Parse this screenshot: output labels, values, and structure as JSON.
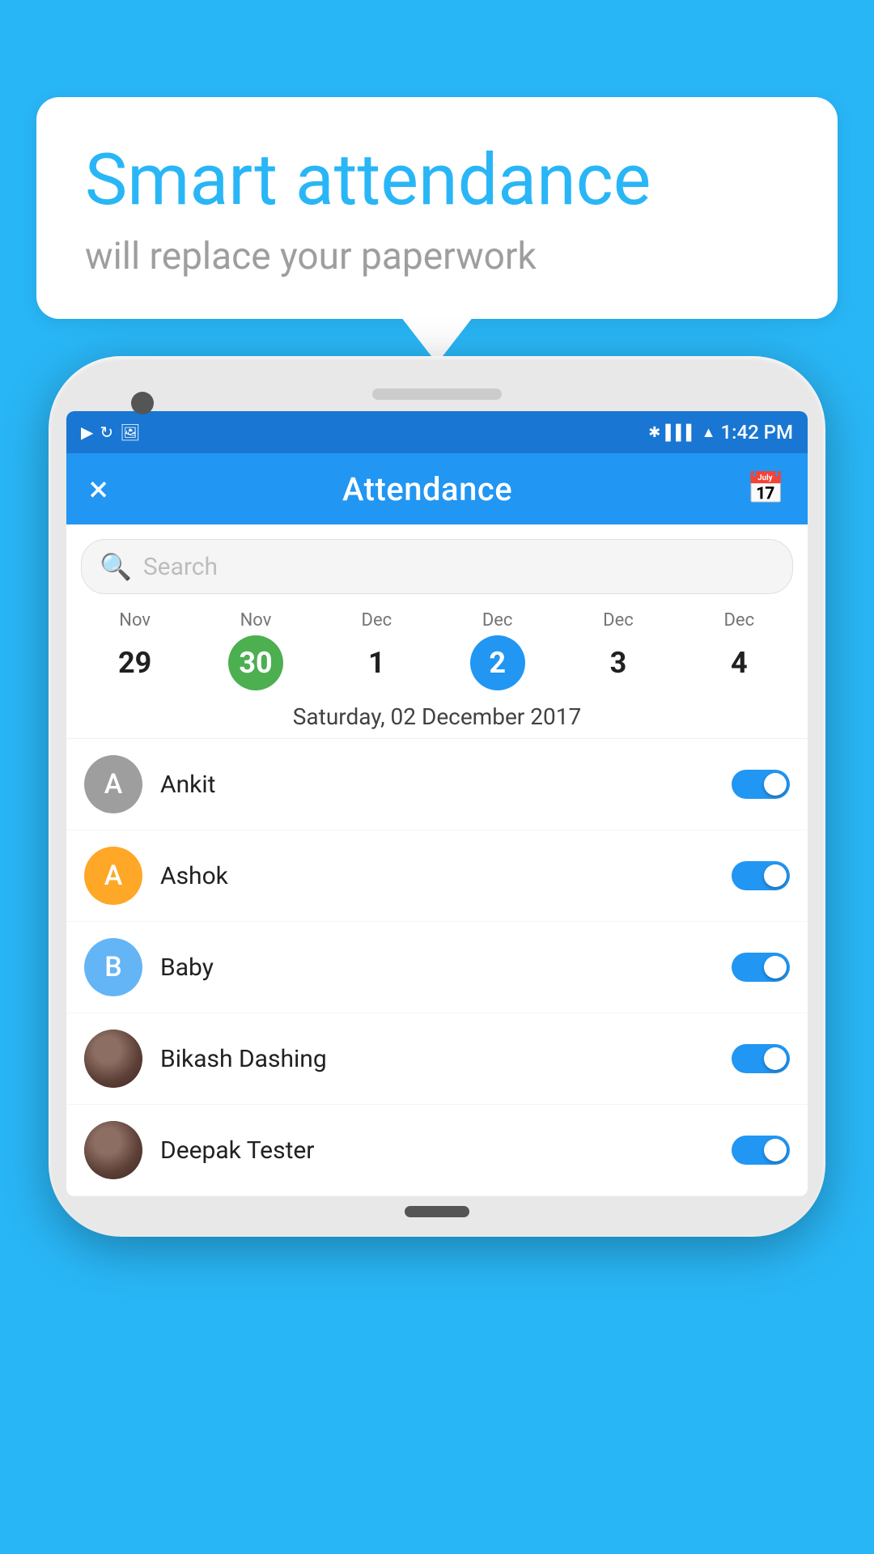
{
  "background_color": "#29B6F6",
  "bubble": {
    "title": "Smart attendance",
    "subtitle": "will replace your paperwork"
  },
  "status_bar": {
    "time": "1:42 PM"
  },
  "header": {
    "title": "Attendance",
    "close_label": "×",
    "calendar_label": "📅"
  },
  "search": {
    "placeholder": "Search"
  },
  "dates": [
    {
      "month": "Nov",
      "day": "29",
      "style": "plain"
    },
    {
      "month": "Nov",
      "day": "30",
      "style": "green"
    },
    {
      "month": "Dec",
      "day": "1",
      "style": "plain"
    },
    {
      "month": "Dec",
      "day": "2",
      "style": "blue"
    },
    {
      "month": "Dec",
      "day": "3",
      "style": "plain"
    },
    {
      "month": "Dec",
      "day": "4",
      "style": "plain"
    }
  ],
  "selected_date_label": "Saturday, 02 December 2017",
  "persons": [
    {
      "id": "ankit",
      "name": "Ankit",
      "avatar_type": "letter",
      "letter": "A",
      "avatar_color": "gray",
      "toggle_on": true
    },
    {
      "id": "ashok",
      "name": "Ashok",
      "avatar_type": "letter",
      "letter": "A",
      "avatar_color": "orange",
      "toggle_on": true
    },
    {
      "id": "baby",
      "name": "Baby",
      "avatar_type": "letter",
      "letter": "B",
      "avatar_color": "light-blue",
      "toggle_on": true
    },
    {
      "id": "bikash",
      "name": "Bikash Dashing",
      "avatar_type": "photo",
      "letter": "",
      "avatar_color": "photo",
      "toggle_on": true
    },
    {
      "id": "deepak",
      "name": "Deepak Tester",
      "avatar_type": "photo",
      "letter": "",
      "avatar_color": "photo",
      "toggle_on": true
    }
  ]
}
